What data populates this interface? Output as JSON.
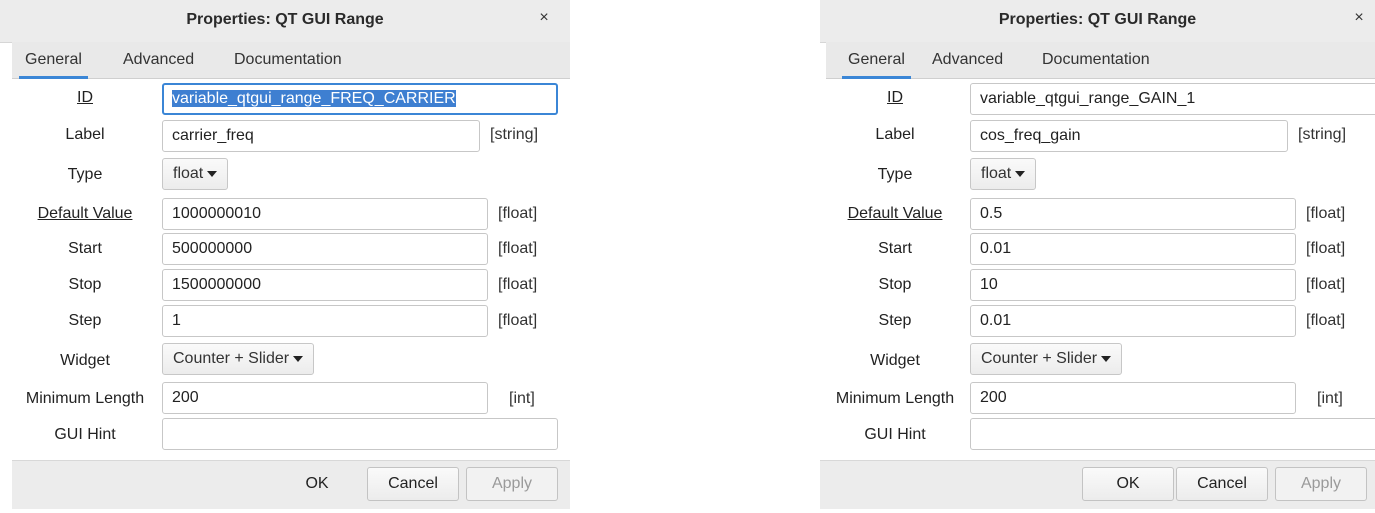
{
  "left": {
    "title": "Properties: QT GUI Range",
    "close": "×",
    "tabs": [
      "General",
      "Advanced",
      "Documentation"
    ],
    "fields": {
      "id": {
        "label": "ID",
        "value": "variable_qtgui_range_FREQ_CARRIER"
      },
      "label": {
        "label": "Label",
        "value": "carrier_freq",
        "type": "[string]"
      },
      "type": {
        "label": "Type",
        "value": "float"
      },
      "default": {
        "label": "Default Value",
        "value": "1000000010",
        "type": "[float]"
      },
      "start": {
        "label": "Start",
        "value": "500000000",
        "type": "[float]"
      },
      "stop": {
        "label": "Stop",
        "value": "1500000000",
        "type": "[float]"
      },
      "step": {
        "label": "Step",
        "value": "1",
        "type": "[float]"
      },
      "widget": {
        "label": "Widget",
        "value": "Counter + Slider"
      },
      "minlen": {
        "label": "Minimum Length",
        "value": "200",
        "type": "[int]"
      },
      "guihint": {
        "label": "GUI Hint",
        "value": ""
      }
    },
    "buttons": {
      "ok": "OK",
      "cancel": "Cancel",
      "apply": "Apply"
    }
  },
  "right": {
    "title": "Properties: QT GUI Range",
    "close": "×",
    "tabs": [
      "General",
      "Advanced",
      "Documentation"
    ],
    "fields": {
      "id": {
        "label": "ID",
        "value": "variable_qtgui_range_GAIN_1"
      },
      "label": {
        "label": "Label",
        "value": "cos_freq_gain",
        "type": "[string]"
      },
      "type": {
        "label": "Type",
        "value": "float"
      },
      "default": {
        "label": "Default Value",
        "value": "0.5",
        "type": "[float]"
      },
      "start": {
        "label": "Start",
        "value": "0.01",
        "type": "[float]"
      },
      "stop": {
        "label": "Stop",
        "value": "10",
        "type": "[float]"
      },
      "step": {
        "label": "Step",
        "value": "0.01",
        "type": "[float]"
      },
      "widget": {
        "label": "Widget",
        "value": "Counter + Slider"
      },
      "minlen": {
        "label": "Minimum Length",
        "value": "200",
        "type": "[int]"
      },
      "guihint": {
        "label": "GUI Hint",
        "value": ""
      }
    },
    "buttons": {
      "ok": "OK",
      "cancel": "Cancel",
      "apply": "Apply"
    }
  },
  "colors": {
    "accent": "#3b86d6",
    "selection": "#3e7fd1",
    "titlebar": "#ececec"
  }
}
